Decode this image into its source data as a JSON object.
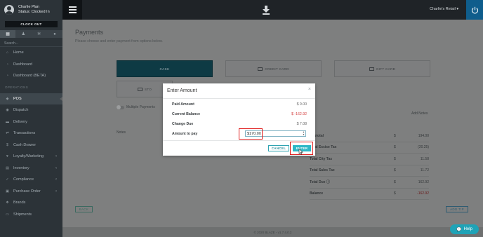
{
  "user": {
    "name": "Charlie Plan",
    "status": "Status: Clocked In",
    "clock_out_label": "CLOCK OUT"
  },
  "sidebar": {
    "tab_icons": [
      "map-icon",
      "user-icon",
      "gear-icon",
      "person-icon"
    ],
    "search_placeholder": "Search...",
    "items": [
      {
        "label": "Home",
        "icon": "home-icon"
      },
      {
        "label": "Dashboard",
        "icon": "dashboard-icon"
      },
      {
        "label": "Dashboard (BETA)",
        "icon": "dashboard-icon"
      },
      {
        "label": "POS",
        "icon": "tag-icon",
        "active": true
      },
      {
        "label": "Dispatch",
        "icon": "dispatch-icon"
      },
      {
        "label": "Delivery",
        "icon": "truck-icon"
      },
      {
        "label": "Transactions",
        "icon": "transactions-icon"
      },
      {
        "label": "Cash Drawer",
        "icon": "cash-icon"
      },
      {
        "label": "Loyalty/Marketing",
        "icon": "loyalty-icon",
        "has_children": true
      },
      {
        "label": "Inventory",
        "icon": "inventory-icon",
        "has_children": true
      },
      {
        "label": "Compliance",
        "icon": "compliance-icon",
        "has_children": true
      },
      {
        "label": "Purchase Order",
        "icon": "purchase-icon",
        "has_children": true
      },
      {
        "label": "Brands",
        "icon": "brands-icon"
      },
      {
        "label": "Shipments",
        "icon": "shipments-icon"
      }
    ]
  },
  "topbar": {
    "store": "Charlie's Retail",
    "colors": {
      "bar": "#1f2327",
      "power": "#0f5d8c"
    }
  },
  "page": {
    "title": "Payments",
    "subtitle": "Please choose and enter payment from options below.",
    "tiles": {
      "cash": "CASH",
      "credit": "CREDIT CARD",
      "gift": "GIFT CARD",
      "store": "STO"
    },
    "multiple_payments": "Multiple Payments",
    "notes_label": "Notes",
    "add_notes_label": "Add Notes",
    "totals": [
      {
        "label": "Subtotal",
        "currency": "$",
        "value": "194.00"
      },
      {
        "label": "Total Excise Tax",
        "currency": "$",
        "value": "(20.25)"
      },
      {
        "label": "Total City Tax",
        "currency": "$",
        "value": "11.58"
      },
      {
        "label": "Total Sales Tax",
        "currency": "$",
        "value": "11.72"
      },
      {
        "label": "Total Due",
        "currency": "$",
        "value": "162.92"
      },
      {
        "label": "Balance",
        "currency": "$",
        "value": "-162.92"
      }
    ],
    "back_label": "BACK",
    "add_tip_label": "ADD TIP"
  },
  "footer": {
    "text": "© 2020 BLAZE - v1.7.4.0.2"
  },
  "help_label": "Help",
  "modal": {
    "title": "Enter Amount",
    "close": "×",
    "rows": [
      {
        "label": "Paid Amount",
        "value": "$ 0.00"
      },
      {
        "label": "Current Balance",
        "value": "$ -162.92"
      },
      {
        "label": "Change Due",
        "value": "$ 7.08"
      }
    ],
    "amount_label": "Amount to pay",
    "amount_value": "$170.00",
    "cancel_label": "CANCEL",
    "enter_label": "ENTER"
  }
}
